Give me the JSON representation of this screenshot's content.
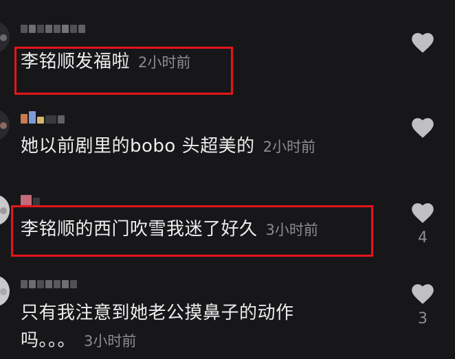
{
  "comments": [
    {
      "text": "李铭顺发福啦",
      "time": "2小时前",
      "likes": "",
      "highlighted": true
    },
    {
      "text": "她以前剧里的bobo 头超美的",
      "time": "2小时前",
      "likes": "",
      "highlighted": false
    },
    {
      "text": "李铭顺的西门吹雪我迷了好久",
      "time": "3小时前",
      "likes": "4",
      "highlighted": true
    },
    {
      "text_line1": "只有我注意到她老公摸鼻子的动作",
      "text_line2": "吗。。。",
      "time": "3小时前",
      "likes": "3",
      "highlighted": false
    }
  ],
  "icons": {
    "like": "heart-icon",
    "avatar": "avatar"
  },
  "colors": {
    "background": "#17171a",
    "text": "#ededed",
    "secondary": "#8d8d92",
    "highlight": "#e8141a",
    "heart": "#bfbfc4"
  }
}
